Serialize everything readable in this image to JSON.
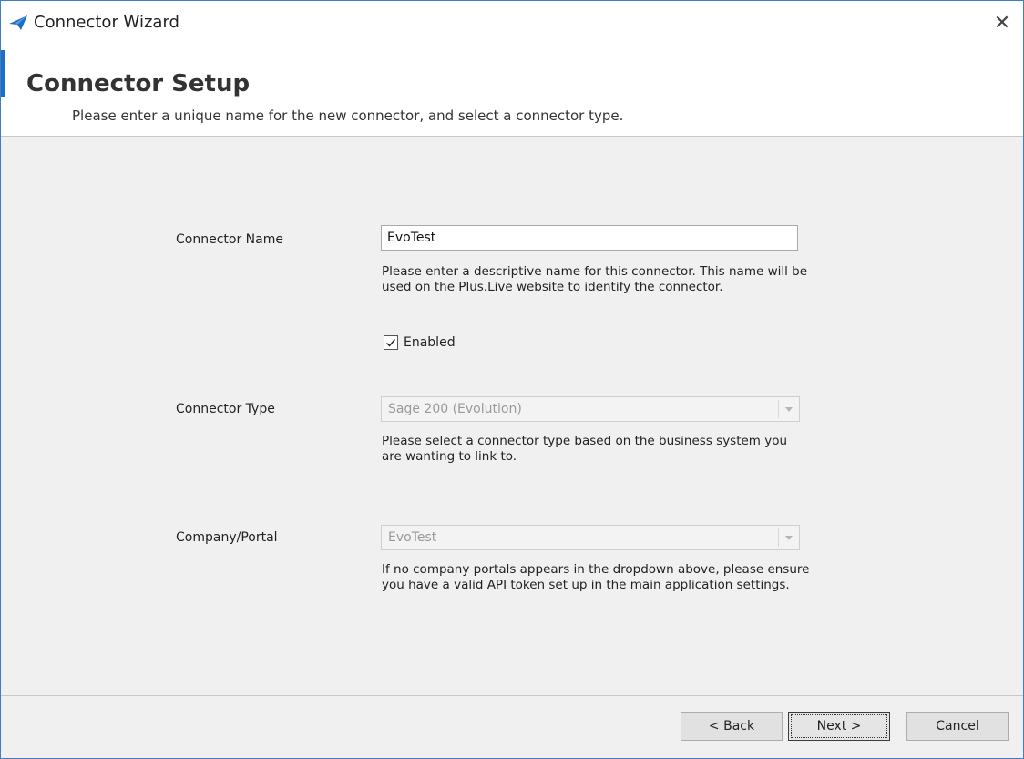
{
  "window": {
    "title": "Connector Wizard",
    "close_glyph": "✕"
  },
  "header": {
    "title": "Connector Setup",
    "subtitle": "Please enter a unique name for the new connector, and select a connector type."
  },
  "form": {
    "connector_name": {
      "label": "Connector Name",
      "value": "EvoTest",
      "help": "Please enter a descriptive name for this connector. This name will be used on the Plus.Live website to identify the connector."
    },
    "enabled": {
      "label": "Enabled",
      "checked": true
    },
    "connector_type": {
      "label": "Connector Type",
      "value": "Sage 200 (Evolution)",
      "help": "Please select a connector type based on the business system you are wanting to link to."
    },
    "company_portal": {
      "label": "Company/Portal",
      "value": "EvoTest",
      "help": "If no company portals appears in the dropdown above, please ensure you have a valid API token set up in the main application settings."
    }
  },
  "footer": {
    "back_label": "< Back",
    "next_label": "Next >",
    "cancel_label": "Cancel"
  },
  "icons": {
    "app": "paper-plane-icon",
    "close": "close-icon",
    "check": "checkmark-icon",
    "dropdown": "chevron-down-icon"
  },
  "colors": {
    "accent": "#1e6fc4",
    "border": "#3c7fc6",
    "panel": "#f0f0f0"
  }
}
